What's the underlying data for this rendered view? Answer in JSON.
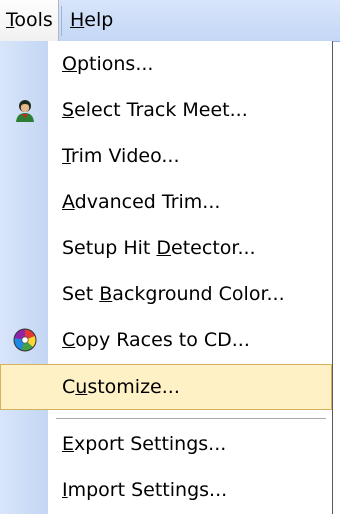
{
  "menubar": {
    "tools": {
      "before": "",
      "mnemonic": "T",
      "after": "ools"
    },
    "help": {
      "before": "",
      "mnemonic": "H",
      "after": "elp"
    }
  },
  "menu": {
    "items": [
      {
        "before": "",
        "mnemonic": "O",
        "after": "ptions...",
        "icon": null
      },
      {
        "before": "",
        "mnemonic": "S",
        "after": "elect Track Meet...",
        "icon": "person-icon"
      },
      {
        "before": "",
        "mnemonic": "T",
        "after": "rim Video...",
        "icon": null
      },
      {
        "before": "",
        "mnemonic": "A",
        "after": "dvanced Trim...",
        "icon": null
      },
      {
        "before": "Setup Hit ",
        "mnemonic": "D",
        "after": "etector...",
        "icon": null
      },
      {
        "before": "Set ",
        "mnemonic": "B",
        "after": "ackground Color...",
        "icon": null
      },
      {
        "before": "",
        "mnemonic": "C",
        "after": "opy Races to CD...",
        "icon": "cd-icon"
      },
      {
        "before": "C",
        "mnemonic": "u",
        "after": "stomize...",
        "icon": null,
        "highlighted": true
      },
      {
        "before": "",
        "mnemonic": "E",
        "after": "xport Settings...",
        "icon": null
      },
      {
        "before": "",
        "mnemonic": "I",
        "after": "mport Settings...",
        "icon": null
      }
    ]
  },
  "colors": {
    "highlight_bg": "#fff1c6",
    "highlight_border": "#d7b25c",
    "gutter": "#c8d9f5"
  }
}
